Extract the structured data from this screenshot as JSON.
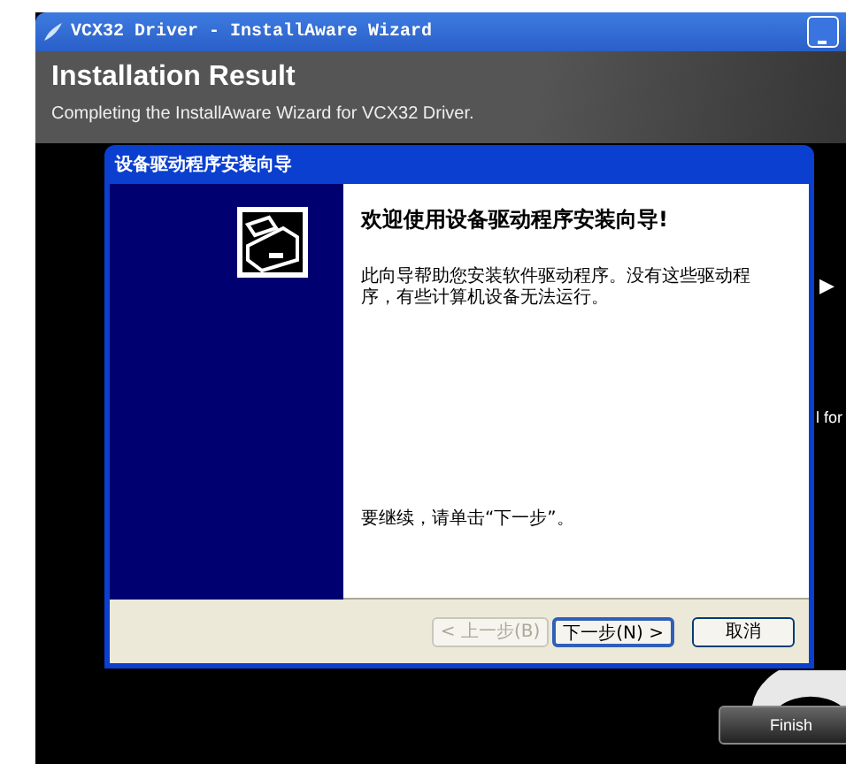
{
  "window": {
    "title": "VCX32 Driver - InstallAware Wizard"
  },
  "header": {
    "title": "Installation Result",
    "subtitle": "Completing the InstallAware Wizard for VCX32 Driver."
  },
  "body": {
    "arrow": "▶",
    "partial_text": "l for",
    "finish_button": "Finish"
  },
  "dialog": {
    "title": "设备驱动程序安装向导",
    "heading": "欢迎使用设备驱动程序安装向导!",
    "description": "此向导帮助您安装软件驱动程序。没有这些驱动程序，有些计算机设备无法运行。",
    "instruction": "要继续，请单击“下一步”。",
    "buttons": [
      {
        "label": "< 上一步(B)",
        "disabled": true,
        "default": false
      },
      {
        "label": "下一步(N) >",
        "disabled": false,
        "default": true
      },
      {
        "label": "取消",
        "disabled": false,
        "default": false
      }
    ]
  }
}
